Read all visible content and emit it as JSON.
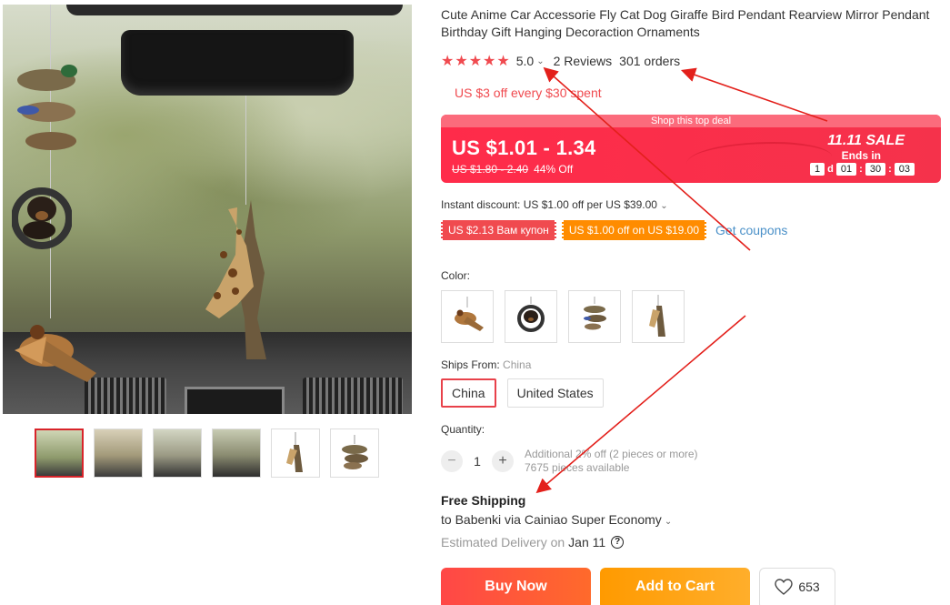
{
  "product": {
    "title": "Cute Anime Car Accessorie Fly Cat Dog Giraffe Bird Pendant Rearview Mirror Pendant Birthday Gift Hanging Decoraction Ornaments"
  },
  "rating": {
    "stars": "★★★★★",
    "score": "5.0",
    "reviews": "2 Reviews",
    "orders": "301 orders"
  },
  "promo_text": "US $3 off every $30 spent",
  "deal": {
    "strip": "Shop this top deal",
    "price": "US $1.01 - 1.34",
    "original_price": "US $1.80 - 2.40",
    "discount": "44% Off",
    "sale_label": "11.11 SALE",
    "ends_in": "Ends in",
    "days": "1",
    "days_unit": "d",
    "hours": "01",
    "minutes": "30",
    "seconds": "03"
  },
  "instant_discount": "Instant discount: US $1.00 off per US $39.00",
  "coupons": {
    "first": "US $2.13 Вам купон",
    "second": "US $1.00 off on US $19.00",
    "get": "Get coupons"
  },
  "color_label": "Color:",
  "ships": {
    "label": "Ships From:",
    "selected_value": "China",
    "options": [
      "China",
      "United States"
    ]
  },
  "quantity": {
    "label": "Quantity:",
    "value": "1",
    "minus": "−",
    "plus": "+",
    "note_line1": "Additional 2% off (2 pieces or more)",
    "note_line2": "7675 pieces available"
  },
  "shipping": {
    "free": "Free Shipping",
    "route": "to Babenki via Cainiao Super Economy",
    "est_label": "Estimated Delivery on",
    "est_date": "Jan 11",
    "help": "?"
  },
  "actions": {
    "buy": "Buy Now",
    "cart": "Add to Cart",
    "wishlist_count": "653"
  },
  "colors": {
    "accent": "#f04a4f",
    "deal": "#ff2b4a",
    "link": "#4a90c8",
    "annotation": "#e3201b"
  }
}
